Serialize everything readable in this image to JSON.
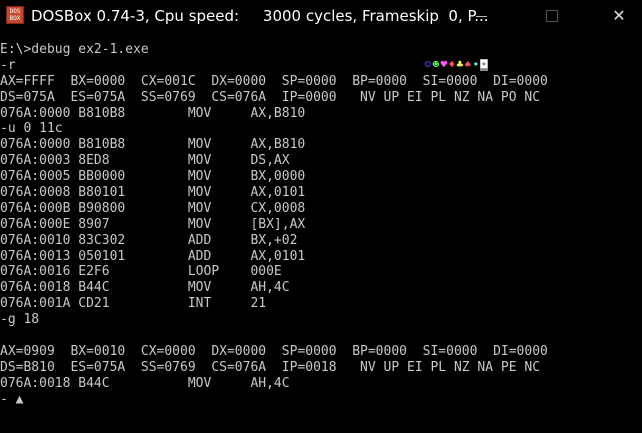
{
  "window": {
    "title": "DOSBox 0.74-3, Cpu speed:     3000 cycles, Frameskip  0, P...",
    "icon_text": "DOS BOX",
    "min_glyph": "—",
    "max_glyph": "□",
    "close_glyph": "✕"
  },
  "terminal": {
    "key_glyphs": [
      "☺",
      "☻",
      "♥",
      "♦",
      "♣",
      "♠",
      "•",
      "◘"
    ],
    "lines": [
      "E:\\>debug ex2-1.exe",
      "-r",
      "AX=FFFF  BX=0000  CX=001C  DX=0000  SP=0000  BP=0000  SI=0000  DI=0000",
      "DS=075A  ES=075A  SS=0769  CS=076A  IP=0000   NV UP EI PL NZ NA PO NC",
      "076A:0000 B810B8        MOV     AX,B810",
      "-u 0 11c",
      "076A:0000 B810B8        MOV     AX,B810",
      "076A:0003 8ED8          MOV     DS,AX",
      "076A:0005 BB0000        MOV     BX,0000",
      "076A:0008 B80101        MOV     AX,0101",
      "076A:000B B90800        MOV     CX,0008",
      "076A:000E 8907          MOV     [BX],AX",
      "076A:0010 83C302        ADD     BX,+02",
      "076A:0013 050101        ADD     AX,0101",
      "076A:0016 E2F6          LOOP    000E",
      "076A:0018 B44C          MOV     AH,4C",
      "076A:001A CD21          INT     21",
      "-g 18",
      "",
      "AX=0909  BX=0010  CX=0000  DX=0000  SP=0000  BP=0000  SI=0000  DI=0000",
      "DS=B810  ES=075A  SS=0769  CS=076A  IP=0018   NV UP EI PL NZ NA PE NC",
      "076A:0018 B44C          MOV     AH,4C",
      "- ▲"
    ]
  }
}
